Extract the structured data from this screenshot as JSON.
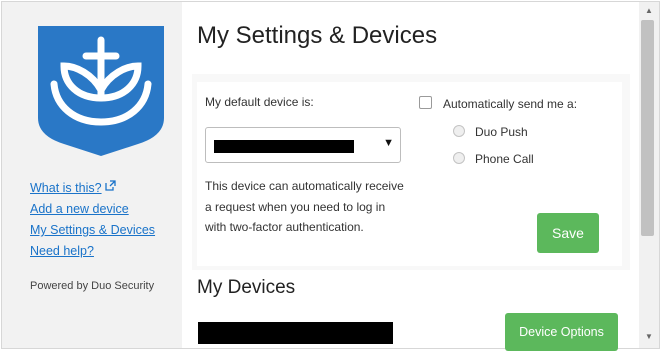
{
  "sidebar": {
    "links": [
      {
        "label": "What is this?"
      },
      {
        "label": "Add a new device"
      },
      {
        "label": "My Settings & Devices"
      },
      {
        "label": "Need help?"
      }
    ],
    "powered_by": "Powered by Duo Security"
  },
  "main": {
    "title": "My Settings & Devices",
    "default_device_label": "My default device is:",
    "device_description": "This device can automatically receive a request when you need to log in with two-factor authentication.",
    "auto_send_label": "Automatically send me a:",
    "auto_send_checked": false,
    "radio_options": [
      "Duo Push",
      "Phone Call"
    ],
    "save_label": "Save",
    "devices_heading": "My Devices",
    "device_options_label": "Device Options"
  },
  "colors": {
    "accent_green": "#5cb85c",
    "logo_blue": "#2a78c6",
    "link_blue": "#1a73c9"
  },
  "icons": [
    "university-logo",
    "external-link-icon",
    "chevron-down-icon",
    "scroll-up-icon",
    "scroll-down-icon"
  ]
}
